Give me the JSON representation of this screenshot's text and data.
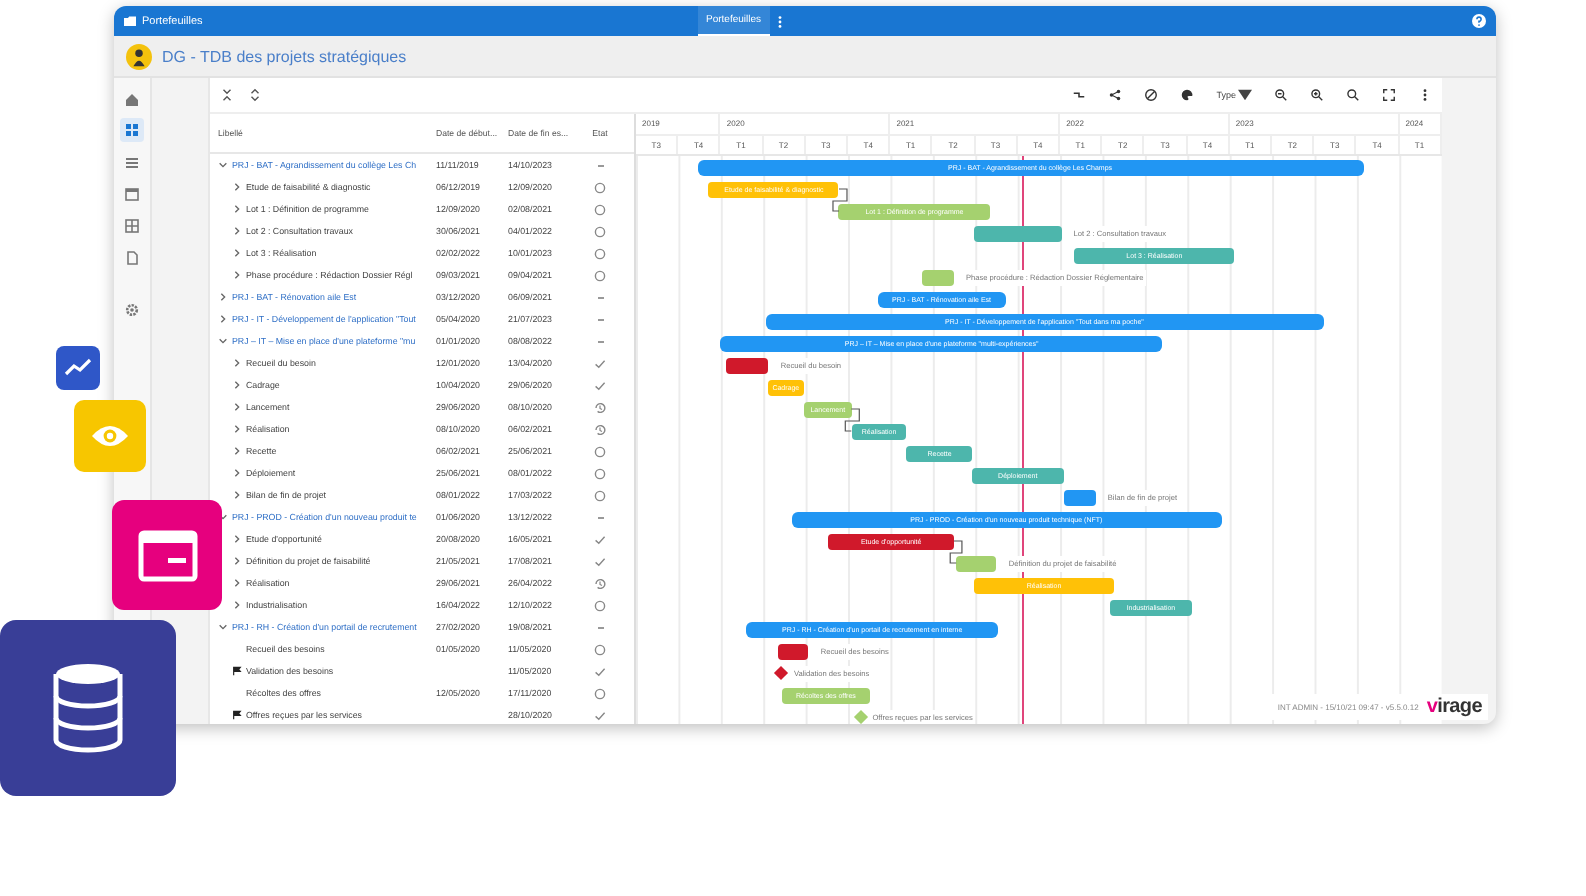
{
  "top_bar": {
    "app_title": "Portefeuilles",
    "tabs": [
      {
        "label": "Portefeuilles",
        "selected": true
      }
    ]
  },
  "title_bar": {
    "title": "DG - TDB des projets stratégiques"
  },
  "rail_items": [
    {
      "selected": false
    },
    {
      "selected": true
    },
    {
      "selected": false
    },
    {
      "selected": false
    },
    {
      "selected": false
    },
    {
      "selected": false
    },
    {
      "selected": false
    }
  ],
  "toolbar": {
    "type_filter": "Type"
  },
  "table": {
    "columns": [
      "Libellé",
      "Date de début...",
      "Date de fin es...",
      "Etat"
    ]
  },
  "gantt": {
    "timeline": [
      {
        "label": "2019",
        "quarters": [
          "T3",
          "T4"
        ]
      },
      {
        "label": "2020",
        "quarters": [
          "T1",
          "T2",
          "T3",
          "T4"
        ]
      },
      {
        "label": "2021",
        "quarters": [
          "T1",
          "T2",
          "T3",
          "T4"
        ]
      },
      {
        "label": "2022",
        "quarters": [
          "T1",
          "T2",
          "T3",
          "T4"
        ]
      },
      {
        "label": "2023",
        "quarters": [
          "T1",
          "T2",
          "T3",
          "T4"
        ]
      },
      {
        "label": "2024",
        "quarters": [
          "T1"
        ]
      }
    ],
    "today_marker": {
      "level": 0.48
    }
  },
  "projects": [
    {
      "label": "PRJ - BAT - Agrandissement du collège Les Ch",
      "start": "11/11/2019",
      "end": "14/10/2023",
      "status": {
        "kind": "none"
      },
      "expanded": true,
      "bar": {
        "label": "PRJ - BAT - Agrandissement du collège Les Champs",
        "color": "#2196f3",
        "label_outside": false
      },
      "children": [
        {
          "kind": "subproject",
          "label": "Etude de faisabilité & diagnostic",
          "start": "06/12/2019",
          "end": "12/09/2020",
          "status": {
            "kind": "todo"
          },
          "linked": false,
          "bar": {
            "label": "Etude de faisabilité & diagnostic",
            "color": "#ffc107",
            "label_outside": false
          }
        },
        {
          "kind": "subproject",
          "label": "Lot 1 : Définition de programme",
          "start": "12/09/2020",
          "end": "02/08/2021",
          "status": {
            "kind": "todo"
          },
          "linked": true,
          "bar": {
            "label": "Lot 1 : Définition de programme",
            "color": "#a5d16f",
            "label_outside": false
          }
        },
        {
          "kind": "subproject",
          "label": "Lot 2 : Consultation travaux",
          "start": "30/06/2021",
          "end": "04/01/2022",
          "status": {
            "kind": "todo"
          },
          "linked": false,
          "bar": {
            "label": "Lot 2 : Consultation travaux",
            "color": "#4db6ac",
            "label_outside": true
          }
        },
        {
          "kind": "subproject",
          "label": "Lot 3 : Réalisation",
          "start": "02/02/2022",
          "end": "10/01/2023",
          "status": {
            "kind": "todo"
          },
          "linked": false,
          "bar": {
            "label": "Lot 3 : Réalisation",
            "color": "#4db6ac",
            "label_outside": false
          }
        },
        {
          "kind": "subproject",
          "label": "Phase procédure : Rédaction Dossier Régl",
          "start": "09/03/2021",
          "end": "09/04/2021",
          "status": {
            "kind": "todo"
          },
          "linked": false,
          "bar": {
            "label": "Phase procédure : Rédaction Dossier Réglementaire",
            "color": "#a5d16f",
            "label_outside": true
          }
        }
      ]
    },
    {
      "label": "PRJ - BAT - Rénovation aile Est",
      "start": "03/12/2020",
      "end": "06/09/2021",
      "status": {
        "kind": "none"
      },
      "expanded": false,
      "bar": {
        "label": "PRJ - BAT - Rénovation aile Est",
        "color": "#2196f3",
        "label_outside": false
      }
    },
    {
      "label": "PRJ - IT - Développement de l'application \"Tout",
      "start": "05/04/2020",
      "end": "21/07/2023",
      "status": {
        "kind": "none"
      },
      "expanded": false,
      "bar": {
        "label": "PRJ - IT - Développement de l'application \"Tout dans ma poche\"",
        "color": "#2196f3",
        "label_outside": false
      }
    },
    {
      "label": "PRJ – IT – Mise en place d'une plateforme \"mu",
      "start": "01/01/2020",
      "end": "08/08/2022",
      "status": {
        "kind": "none"
      },
      "expanded": true,
      "bar": {
        "label": "PRJ – IT – Mise en place d'une plateforme \"multi-expériences\"",
        "color": "#2196f3",
        "label_outside": false
      },
      "children": [
        {
          "kind": "subproject",
          "label": "Recueil du besoin",
          "start": "12/01/2020",
          "end": "13/04/2020",
          "status": {
            "kind": "done"
          },
          "linked": false,
          "bar": {
            "label": "Recueil du besoin",
            "color": "#d0192b",
            "label_outside": true
          }
        },
        {
          "kind": "subproject",
          "label": "Cadrage",
          "start": "10/04/2020",
          "end": "29/06/2020",
          "status": {
            "kind": "done"
          },
          "linked": false,
          "bar": {
            "label": "Cadrage",
            "color": "#ffc107",
            "label_outside": false
          }
        },
        {
          "kind": "subproject",
          "label": "Lancement",
          "start": "29/06/2020",
          "end": "08/10/2020",
          "status": {
            "kind": "in_progress"
          },
          "linked": false,
          "bar": {
            "label": "Lancement",
            "color": "#a5d16f",
            "label_outside": false
          }
        },
        {
          "kind": "subproject",
          "label": "Réalisation",
          "start": "08/10/2020",
          "end": "06/02/2021",
          "status": {
            "kind": "in_progress"
          },
          "linked": true,
          "bar": {
            "label": "Réalisation",
            "color": "#4db6ac",
            "label_outside": false
          }
        },
        {
          "kind": "subproject",
          "label": "Recette",
          "start": "06/02/2021",
          "end": "25/06/2021",
          "status": {
            "kind": "todo"
          },
          "linked": false,
          "bar": {
            "label": "Recette",
            "color": "#4db6ac",
            "label_outside": false
          }
        },
        {
          "kind": "subproject",
          "label": "Déploiement",
          "start": "25/06/2021",
          "end": "08/01/2022",
          "status": {
            "kind": "todo"
          },
          "linked": false,
          "bar": {
            "label": "Déploiement",
            "color": "#4db6ac",
            "label_outside": false
          }
        },
        {
          "kind": "subproject",
          "label": "Bilan de fin de projet",
          "start": "08/01/2022",
          "end": "17/03/2022",
          "status": {
            "kind": "todo"
          },
          "linked": false,
          "bar": {
            "label": "Bilan de fin de projet",
            "color": "#2196f3",
            "label_outside": true
          }
        }
      ]
    },
    {
      "label": "PRJ - PROD - Création d'un nouveau produit te",
      "start": "01/06/2020",
      "end": "13/12/2022",
      "status": {
        "kind": "none"
      },
      "expanded": true,
      "bar": {
        "label": "PRJ - PROD - Création d'un nouveau produit technique (NFT)",
        "color": "#2196f3",
        "label_outside": false
      },
      "children": [
        {
          "kind": "subproject",
          "label": "Etude d'opportunité",
          "start": "20/08/2020",
          "end": "16/05/2021",
          "status": {
            "kind": "done"
          },
          "linked": false,
          "bar": {
            "label": "Etude d'opportunité",
            "color": "#d0192b",
            "label_outside": false
          }
        },
        {
          "kind": "subproject",
          "label": "Définition du projet de faisabilité",
          "start": "21/05/2021",
          "end": "17/08/2021",
          "status": {
            "kind": "done"
          },
          "linked": true,
          "bar": {
            "label": "Définition du projet de faisabilité",
            "color": "#a5d16f",
            "label_outside": true
          }
        },
        {
          "kind": "subproject",
          "label": "Réalisation",
          "start": "29/06/2021",
          "end": "26/04/2022",
          "status": {
            "kind": "in_progress"
          },
          "linked": false,
          "bar": {
            "label": "Réalisation",
            "color": "#ffc107",
            "label_outside": false
          }
        },
        {
          "kind": "subproject",
          "label": "Industrialisation",
          "start": "16/04/2022",
          "end": "12/10/2022",
          "status": {
            "kind": "todo"
          },
          "linked": false,
          "bar": {
            "label": "Industrialisation",
            "color": "#4db6ac",
            "label_outside": false
          }
        }
      ]
    },
    {
      "label": "PRJ - RH - Création d'un portail de recrutement",
      "start": "27/02/2020",
      "end": "19/08/2021",
      "status": {
        "kind": "none"
      },
      "expanded": true,
      "bar": {
        "label": "PRJ - RH - Création d'un portail de recrutement en interne",
        "color": "#2196f3",
        "label_outside": false
      },
      "children": [
        {
          "kind": "task",
          "label": "Recueil des besoins",
          "start": "01/05/2020",
          "end": "11/05/2020",
          "status": {
            "kind": "todo"
          },
          "linked": false,
          "bar": {
            "label": "Recueil des besoins",
            "color": "#d0192b",
            "label_outside": true
          }
        },
        {
          "kind": "milestone",
          "label": "Validation des besoins",
          "end": "11/05/2020",
          "status": {
            "kind": "done"
          },
          "linked": false,
          "bar": {
            "label": "Validation des besoins",
            "color": "#d0192b",
            "label_outside": true
          }
        },
        {
          "kind": "task",
          "label": "Récoltes des offres",
          "start": "12/05/2020",
          "end": "17/11/2020",
          "status": {
            "kind": "todo"
          },
          "linked": false,
          "bar": {
            "label": "Récoltes des offres",
            "color": "#a5d16f",
            "label_outside": false
          }
        },
        {
          "kind": "milestone",
          "label": "Offres reçues par les services",
          "end": "28/10/2020",
          "status": {
            "kind": "done"
          },
          "linked": false,
          "bar": {
            "label": "Offres reçues par les services",
            "color": "#a5d16f",
            "label_outside": true
          }
        }
      ]
    }
  ],
  "footer": {
    "info": "INT ADMIN - 15/10/21 09:47 - v5.5.0.12",
    "logo": "virage"
  }
}
